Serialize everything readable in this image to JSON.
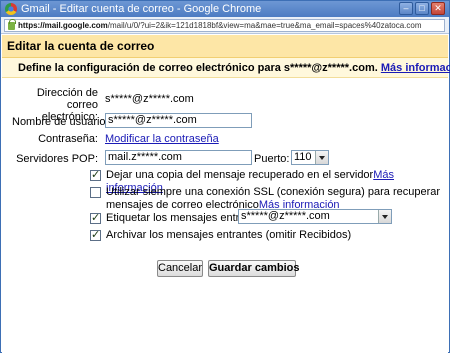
{
  "window": {
    "title": "Gmail - Editar cuenta de correo - Google Chrome",
    "url_host": "https://mail.google.com",
    "url_path": "/mail/u/0/?ui=2&ik=121d1818bf&view=ma&mae=true&ma_email=spaces%40zatoca.com"
  },
  "panel": {
    "title": "Editar la cuenta de correo",
    "intro_prefix": "Define la configuración de correo electrónico para ",
    "intro_email": "s*****@z*****.com.",
    "intro_link": "Más información"
  },
  "form": {
    "email_label": "Dirección de correo electrónico:",
    "email_value": "s*****@z*****.com",
    "username_label": "Nombre de usuario:",
    "username_value": "s*****@z*****.com",
    "password_label": "Contraseña:",
    "password_link": "Modificar la contraseña",
    "pop_label": "Servidores POP:",
    "pop_value": "mail.z*****.com",
    "port_label": "Puerto:",
    "port_value": "110"
  },
  "options": [
    {
      "text": "Dejar una copia del mensaje recuperado en el servidor",
      "link": "Más información",
      "checked": true
    },
    {
      "text": "Utilizar siempre una conexión SSL (conexión segura) para recuperar mensajes de correo electrónico",
      "link": "Más información",
      "checked": false
    },
    {
      "text": "Etiquetar los mensajes entrantes:",
      "select_value": "s*****@z*****.com",
      "checked": true
    },
    {
      "text": "Archivar los mensajes entrantes (omitir Recibidos)",
      "checked": true
    }
  ],
  "buttons": {
    "cancel": "Cancelar",
    "save": "Guardar cambios"
  },
  "icons": {
    "app": "chrome-icon",
    "lock": "ssl-lock-icon",
    "dropdown": "chevron-down-icon"
  }
}
